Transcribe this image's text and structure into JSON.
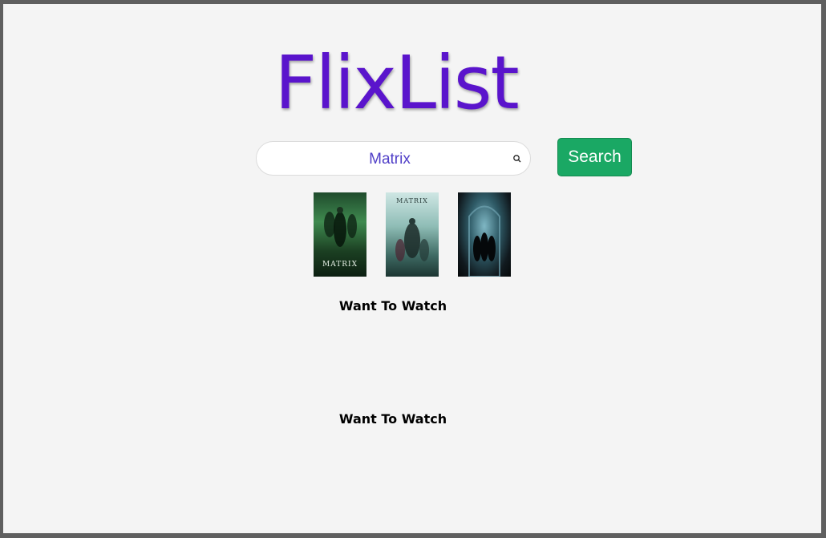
{
  "app": {
    "title": "FlixList"
  },
  "search": {
    "value": "Matrix",
    "button_label": "Search"
  },
  "results": [
    {
      "caption": "MATRIX"
    },
    {
      "caption": "MATRIX"
    },
    {
      "caption": ""
    }
  ],
  "lists": [
    {
      "heading": "Want To Watch"
    },
    {
      "heading": "Want To Watch"
    }
  ],
  "colors": {
    "title": "#5a14cc",
    "search_text": "#5140c8",
    "button": "#1aa864",
    "background": "#f4f4f4"
  }
}
